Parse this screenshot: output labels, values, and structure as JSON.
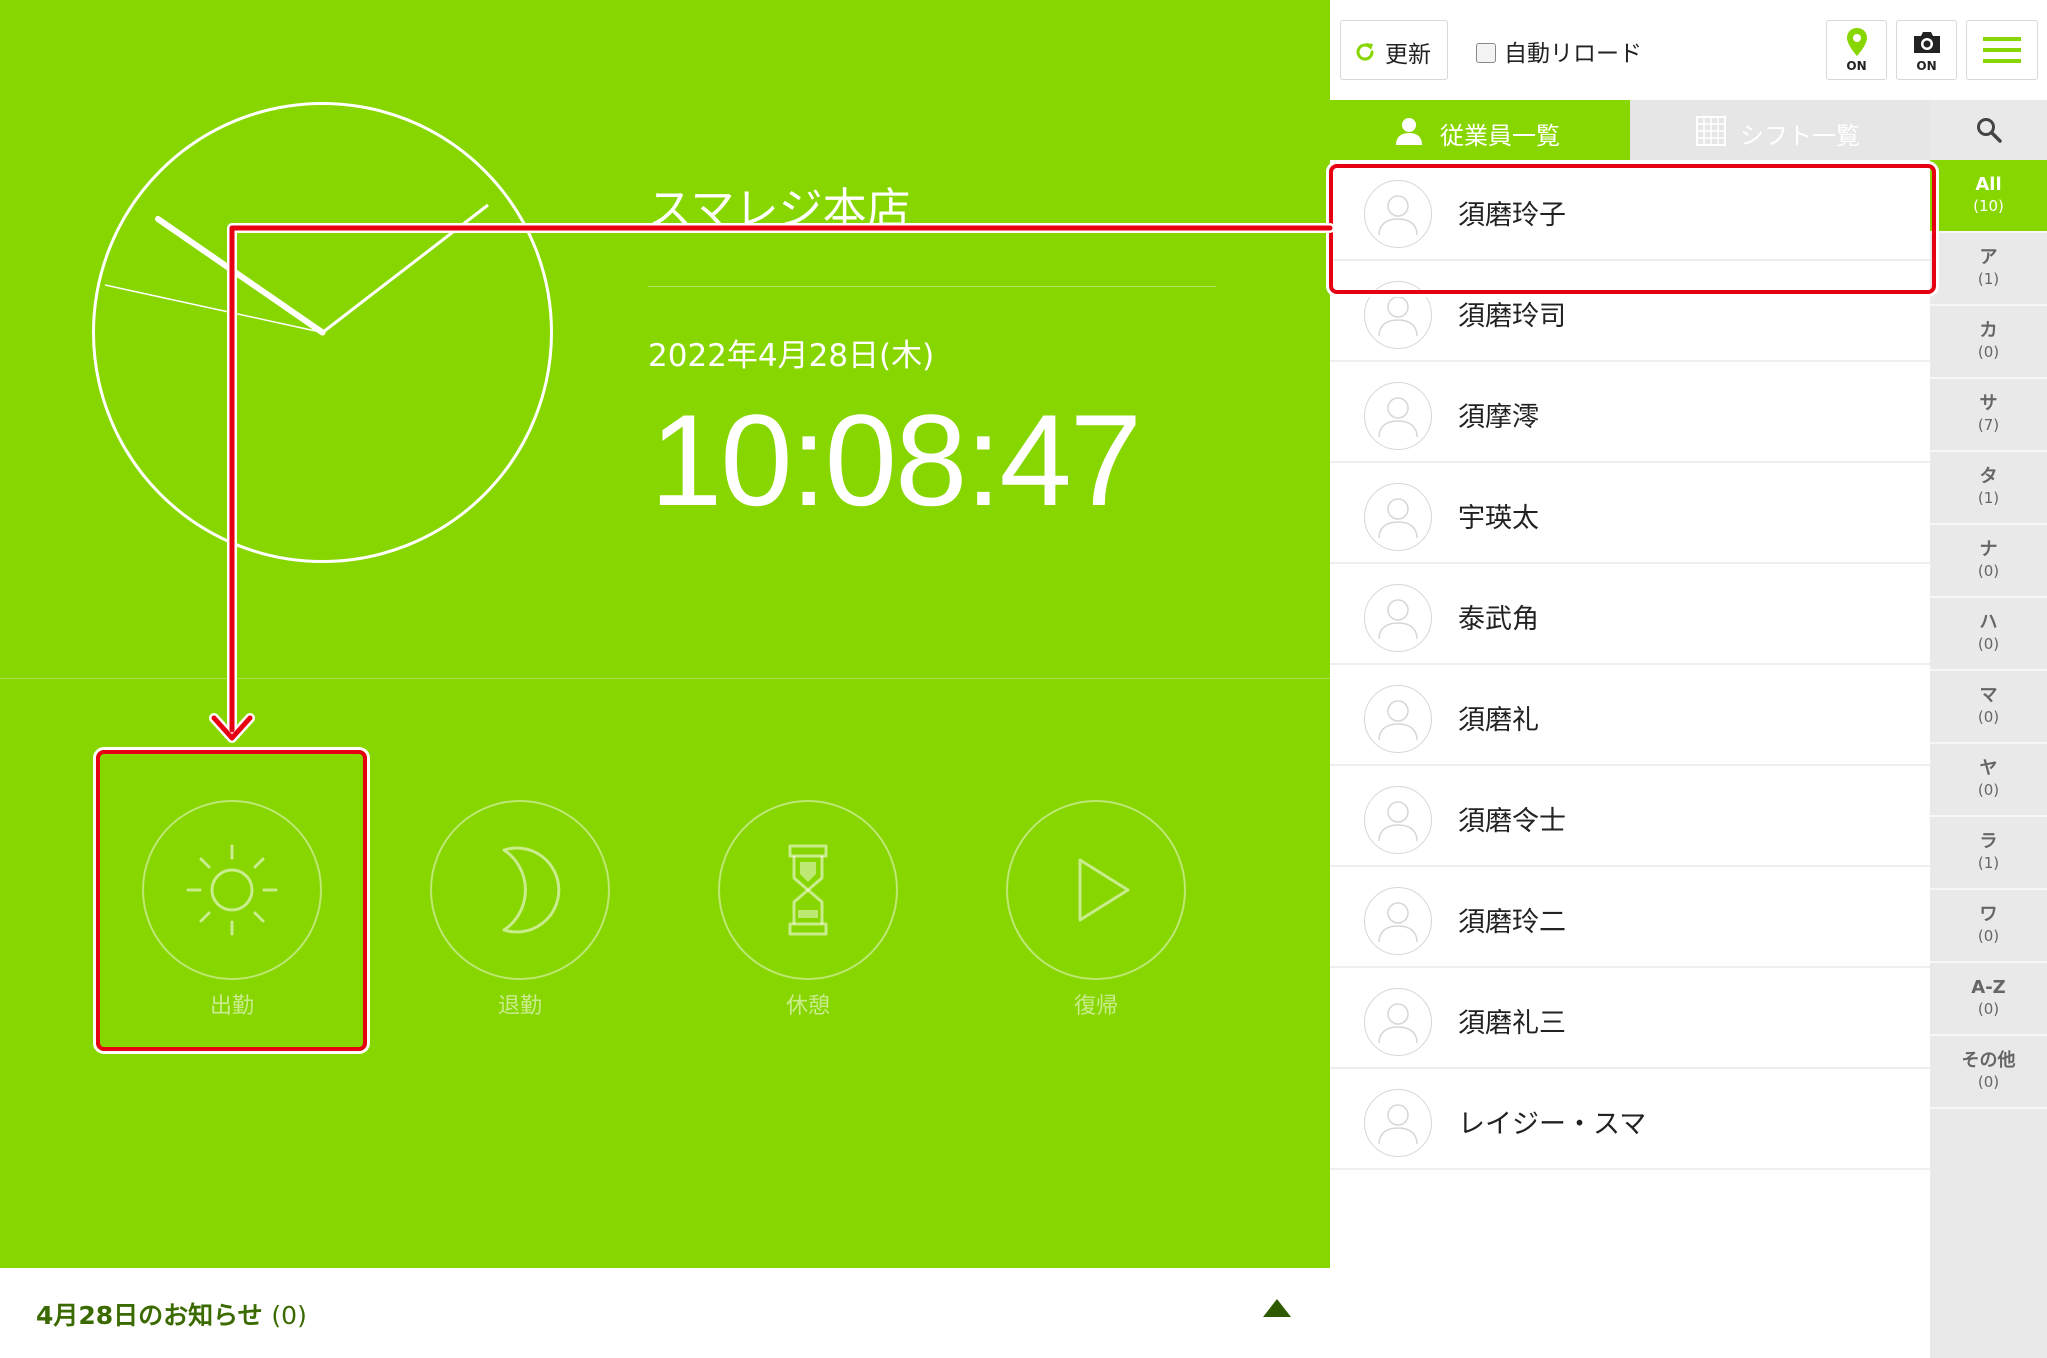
{
  "clock": {
    "store_name": "スマレジ本店",
    "date": "2022年4月28日(木)",
    "time": "10:08:47"
  },
  "punch_buttons": [
    {
      "label": "出勤",
      "icon": "sun-icon"
    },
    {
      "label": "退勤",
      "icon": "moon-icon"
    },
    {
      "label": "休憩",
      "icon": "hourglass-icon"
    },
    {
      "label": "復帰",
      "icon": "play-icon"
    }
  ],
  "notice": {
    "title": "4月28日のお知らせ",
    "count": "(0)"
  },
  "toolbar": {
    "refresh_label": "更新",
    "auto_reload_label": "自動リロード",
    "geo_status": "ON",
    "camera_status": "ON"
  },
  "tabs": {
    "employees": "従業員一覧",
    "shifts": "シフト一覧"
  },
  "employees": [
    {
      "name": "須磨玲子"
    },
    {
      "name": "須磨玲司"
    },
    {
      "name": "須摩澪"
    },
    {
      "name": "宇瑛太"
    },
    {
      "name": "泰武角"
    },
    {
      "name": "須磨礼"
    },
    {
      "name": "須磨令士"
    },
    {
      "name": "須磨玲二"
    },
    {
      "name": "須磨礼三"
    },
    {
      "name": "レイジー・スマ"
    }
  ],
  "index": [
    {
      "key": "All",
      "count": "(10)",
      "active": true
    },
    {
      "key": "ア",
      "count": "(1)"
    },
    {
      "key": "カ",
      "count": "(0)"
    },
    {
      "key": "サ",
      "count": "(7)"
    },
    {
      "key": "タ",
      "count": "(1)"
    },
    {
      "key": "ナ",
      "count": "(0)"
    },
    {
      "key": "ハ",
      "count": "(0)"
    },
    {
      "key": "マ",
      "count": "(0)"
    },
    {
      "key": "ヤ",
      "count": "(0)"
    },
    {
      "key": "ラ",
      "count": "(1)"
    },
    {
      "key": "ワ",
      "count": "(0)"
    },
    {
      "key": "A-Z",
      "count": "(0)"
    },
    {
      "key": "その他",
      "count": "(0)"
    }
  ],
  "colors": {
    "accent": "#88d600",
    "highlight": "#e60012"
  }
}
